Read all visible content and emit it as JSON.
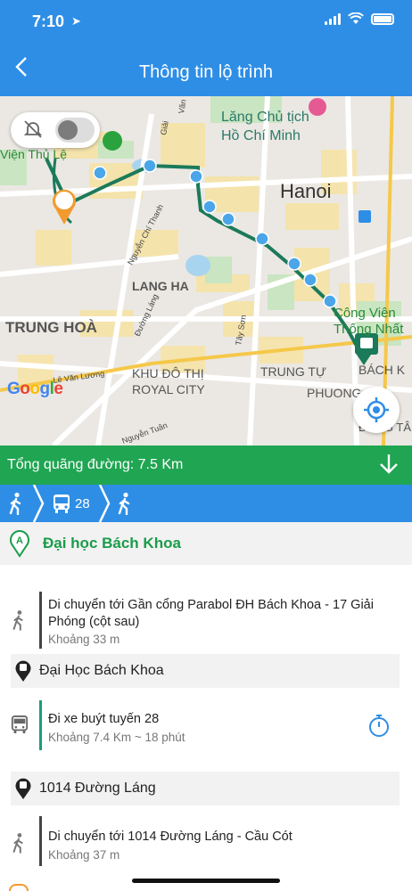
{
  "status_bar": {
    "time": "7:10",
    "location_arrow": "location-arrow-icon"
  },
  "nav": {
    "back_icon": "chevron-left-icon",
    "title": "Thông tin lộ trình"
  },
  "map": {
    "labels": {
      "mausoleum": "Lăng Chủ tịch\nHồ Chí Minh",
      "vien": "Viện Thủ Lệ",
      "hanoi": "Hanoi",
      "lang_ha": "LANG HA",
      "trung_hoa": "TRUNG HOÀ",
      "khu_do_thi": "KHU ĐÔ THỊ",
      "royal_city": "ROYAL CITY",
      "trung_tu": "TRUNG TỰ",
      "phuong_li": "PHUONG LI",
      "bach_k": "BÁCH K",
      "cong_vien": "Công Viên",
      "thong_nhat": "Thống Nhất",
      "dong_tam": "ĐỒNG TÂM",
      "nguyen_chi_thanh": "Nguyễn Chí Thanh",
      "duong_lang": "Đường Láng",
      "le_van_luong": "Lê Văn Lương",
      "nguyen_tuan": "Nguyễn Tuân",
      "tay_son": "Tây Sơn",
      "kim_ma": "Giải",
      "van": "Văn",
      "google": "Google"
    },
    "route_color": "#1b7a5a",
    "stop_color": "#4aa6e8"
  },
  "distance": {
    "text": "Tổng quãng đường: 7.5 Km",
    "icon": "arrow-down-icon"
  },
  "steps_bar": {
    "bus_number": "28"
  },
  "start": {
    "marker": "A",
    "name": "Đại học Bách Khoa"
  },
  "steps": [
    {
      "type": "walk",
      "title": "Di chuyển tới Gần cổng Parabol ĐH Bách Khoa - 17 Giải Phóng (cột sau)",
      "sub": "Khoảng 33 m"
    },
    {
      "type": "stop",
      "title": "Đại Học Bách Khoa"
    },
    {
      "type": "bus",
      "title": "Đi xe buýt tuyến 28",
      "sub": "Khoảng 7.4 Km ~ 18 phút"
    },
    {
      "type": "stop",
      "title": "1014 Đường Láng"
    },
    {
      "type": "walk",
      "title": "Di chuyển tới 1014 Đường Láng -  Cầu Cót",
      "sub": "Khoảng 37 m"
    }
  ]
}
